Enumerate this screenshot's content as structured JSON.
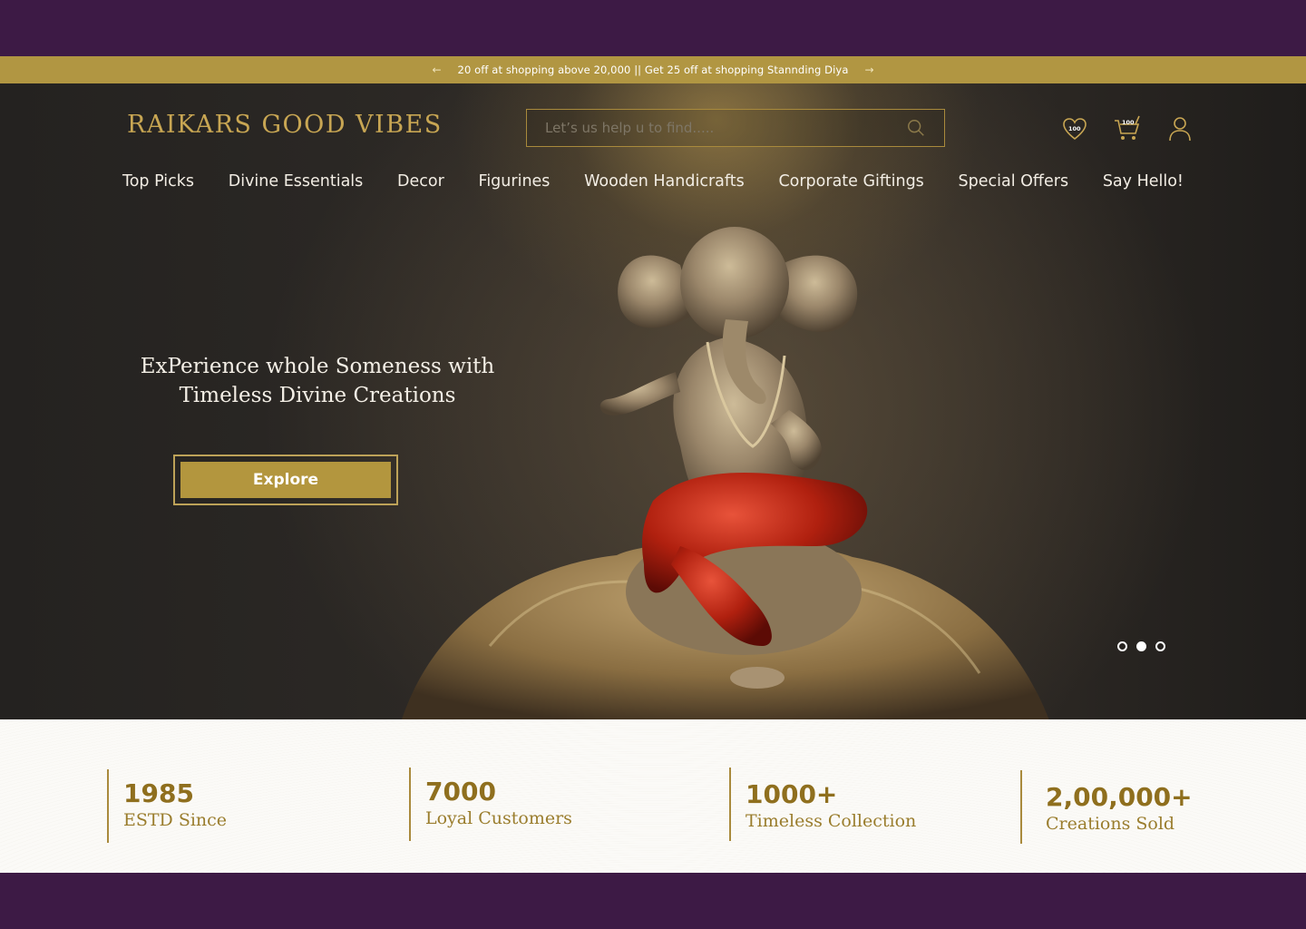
{
  "promo": {
    "text": "20 off at shopping above 20,000 || Get 25 off at shopping Stannding Diya",
    "prev_icon": "arrow-left-icon",
    "next_icon": "arrow-right-icon"
  },
  "header": {
    "logo": "RAIKARS GOOD VIBES",
    "search_placeholder": "Let’s us help u to find.....",
    "wishlist_count": "100",
    "cart_count": "100"
  },
  "nav": {
    "items": [
      "Top Picks",
      "Divine Essentials",
      "Decor",
      "Figurines",
      "Wooden Handicrafts",
      "Corporate Giftings",
      "Special Offers",
      "Say Hello!"
    ]
  },
  "hero": {
    "tagline_line1": "ExPerience whole Someness  with",
    "tagline_line2": "Timeless Divine Creations",
    "cta": "Explore",
    "slides_total": 3,
    "active_slide": 2
  },
  "stats": [
    {
      "value": "1985",
      "label": "ESTD Since"
    },
    {
      "value": "7000",
      "label": "Loyal Customers"
    },
    {
      "value": "1000+",
      "label": "Timeless Collection"
    },
    {
      "value": "2,00,000+",
      "label": "Creations Sold"
    }
  ],
  "colors": {
    "frame": "#3d1a45",
    "gold": "#b19642",
    "gold_text": "#8f6f1e",
    "hero_dark": "#2a2724"
  }
}
